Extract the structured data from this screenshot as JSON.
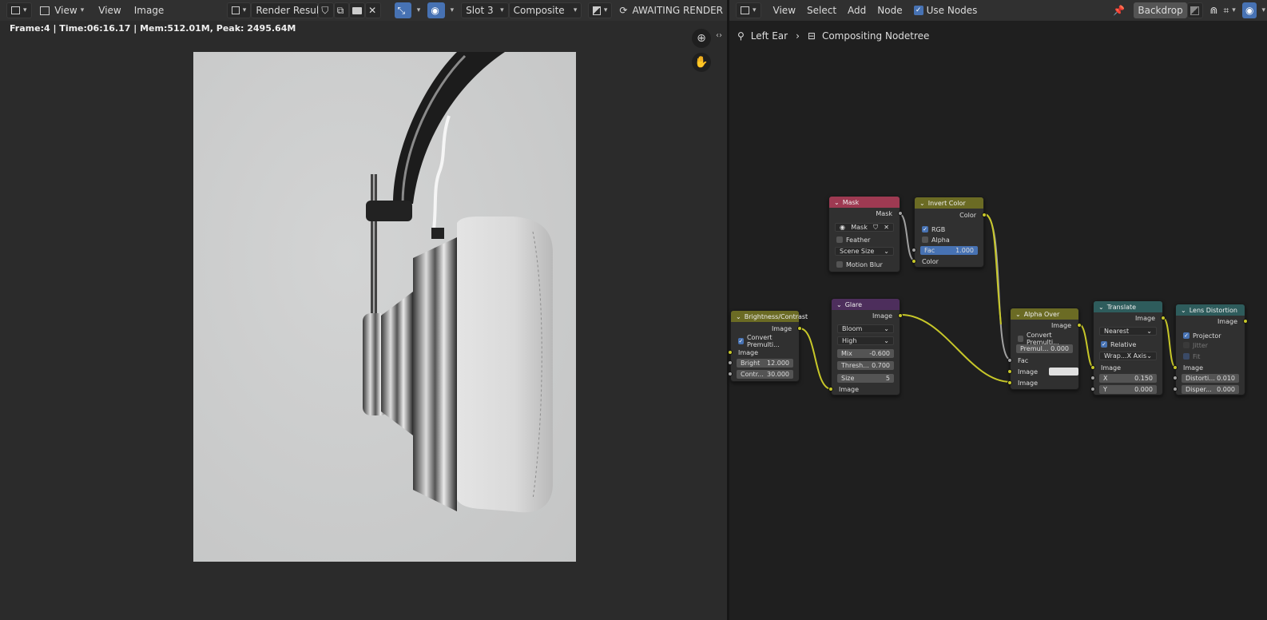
{
  "left_header": {
    "view_menu": "View",
    "view": "View",
    "image": "Image",
    "image_name": "Render Result",
    "slot": "Slot 3",
    "layer": "Composite",
    "status": "AWAITING RENDER"
  },
  "right_header": {
    "view": "View",
    "select": "Select",
    "add": "Add",
    "node": "Node",
    "use_nodes": "Use Nodes",
    "backdrop": "Backdrop"
  },
  "stats": "Frame:4 | Time:06:16.17 | Mem:512.01M, Peak: 2495.64M",
  "breadcrumb": {
    "object": "Left Ear",
    "tree": "Compositing Nodetree"
  },
  "nodes": {
    "mask": {
      "title": "Mask",
      "out": "Mask",
      "mask_name": "Mask",
      "feather": "Feather",
      "size": "Scene Size",
      "motion_blur": "Motion Blur",
      "color": "#9e3a52"
    },
    "invert": {
      "title": "Invert Color",
      "out": "Color",
      "rgb": "RGB",
      "alpha": "Alpha",
      "fac_label": "Fac",
      "fac": "1.000",
      "in": "Color",
      "color": "#6b6b24"
    },
    "bc": {
      "title": "Brightness/Contrast",
      "out": "Image",
      "convert": "Convert Premulti...",
      "in": "Image",
      "bright_label": "Bright",
      "bright": "12.000",
      "contr_label": "Contr...",
      "contr": "30.000",
      "color": "#6b6b24"
    },
    "glare": {
      "title": "Glare",
      "out": "Image",
      "type": "Bloom",
      "quality": "High",
      "mix_label": "Mix",
      "mix": "-0.600",
      "thresh_label": "Thresh...",
      "thresh": "0.700",
      "size_label": "Size",
      "size": "5",
      "in": "Image",
      "color": "#4d2e5c"
    },
    "alpha": {
      "title": "Alpha Over",
      "out": "Image",
      "convert": "Convert Premulti...",
      "premul_label": "Premul...",
      "premul": "0.000",
      "fac": "Fac",
      "in1": "Image",
      "in2": "Image",
      "color": "#6b6b24"
    },
    "translate": {
      "title": "Translate",
      "out": "Image",
      "interp": "Nearest",
      "relative": "Relative",
      "wrap_label": "Wrap...",
      "wrap": "X Axis",
      "in": "Image",
      "x_label": "X",
      "x": "0.150",
      "y_label": "Y",
      "y": "0.000",
      "color": "#2e5c5c"
    },
    "lens": {
      "title": "Lens Distortion",
      "out": "Image",
      "projector": "Projector",
      "jitter": "Jitter",
      "fit": "Fit",
      "in": "Image",
      "dist_label": "Distorti...",
      "dist": "0.010",
      "disp_label": "Disper...",
      "disp": "0.000",
      "color": "#2e5c5c"
    }
  }
}
